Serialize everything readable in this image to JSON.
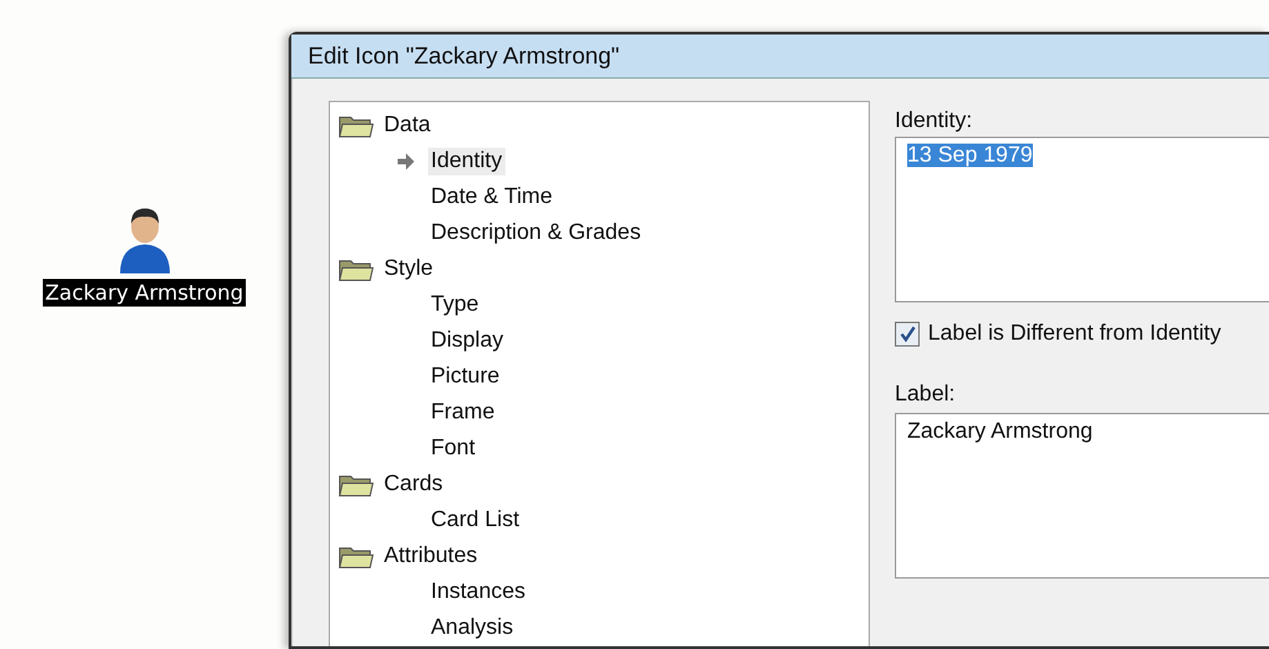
{
  "desktop_icon": {
    "label": "Zackary Armstrong",
    "selected": true
  },
  "window": {
    "title": "Edit Icon \"Zackary Armstrong\""
  },
  "tree": [
    {
      "label": "Data",
      "kind": "folder",
      "children": [
        {
          "label": "Identity",
          "selected": true
        },
        {
          "label": "Date & Time",
          "selected": false
        },
        {
          "label": "Description & Grades",
          "selected": false
        }
      ]
    },
    {
      "label": "Style",
      "kind": "folder",
      "children": [
        {
          "label": "Type",
          "selected": false
        },
        {
          "label": "Display",
          "selected": false
        },
        {
          "label": "Picture",
          "selected": false
        },
        {
          "label": "Frame",
          "selected": false
        },
        {
          "label": "Font",
          "selected": false
        }
      ]
    },
    {
      "label": "Cards",
      "kind": "folder",
      "children": [
        {
          "label": "Card List",
          "selected": false
        }
      ]
    },
    {
      "label": "Attributes",
      "kind": "folder",
      "children": [
        {
          "label": "Instances",
          "selected": false
        },
        {
          "label": "Analysis",
          "selected": false
        }
      ]
    }
  ],
  "identity": {
    "label": "Identity:",
    "value": "13 Sep 1979",
    "text_selected": true
  },
  "label_different": {
    "label": "Label is Different from Identity",
    "checked": true
  },
  "label_field": {
    "label": "Label:",
    "value": "Zackary Armstrong"
  }
}
